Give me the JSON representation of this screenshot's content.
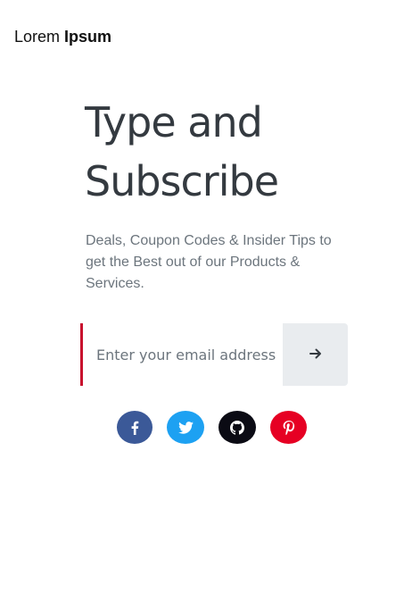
{
  "brand": {
    "light_text": "Lorem",
    "bold_text": "Ipsum"
  },
  "hero": {
    "headline_line1": "Type and",
    "headline_line2": "Subscribe",
    "description": "Deals, Coupon Codes & Insider Tips to get the Best out of our Products & Services."
  },
  "form": {
    "email_placeholder": "Enter your email address",
    "email_value": "",
    "submit_icon": "arrow-right-icon"
  },
  "social": {
    "items": [
      {
        "name": "facebook",
        "icon": "facebook-icon",
        "color": "#3b5998"
      },
      {
        "name": "twitter",
        "icon": "twitter-icon",
        "color": "#1da1f2"
      },
      {
        "name": "github",
        "icon": "github-icon",
        "color": "#0b0b14"
      },
      {
        "name": "pinterest",
        "icon": "pinterest-icon",
        "color": "#e60023"
      }
    ]
  },
  "colors": {
    "accent_border": "#c8102e",
    "heading": "#343a40",
    "muted_text": "#6c757d",
    "button_bg": "#e9ecef"
  }
}
